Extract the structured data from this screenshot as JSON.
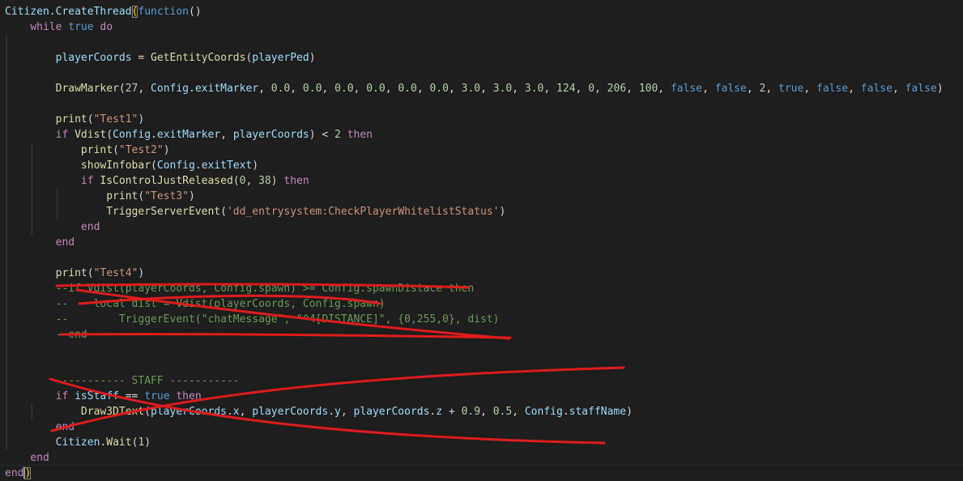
{
  "colors": {
    "background": "#1e1e1e",
    "default": "#d4d4d4",
    "keyword": "#569cd6",
    "control": "#c586c0",
    "function": "#dcdcaa",
    "variable": "#9cdcfe",
    "number": "#b5cea8",
    "string": "#ce9178",
    "comment": "#6a9955",
    "bracket": "#ffd700",
    "annotation": "#e01b1b"
  },
  "lines": [
    {
      "indent": 0,
      "tokens": [
        [
          "Citizen.CreateThread",
          "variable"
        ],
        [
          "(",
          "bracket-hl-tok"
        ],
        [
          "function",
          "keyword"
        ],
        [
          "()",
          "default"
        ]
      ]
    },
    {
      "indent": 1,
      "tokens": [
        [
          "while",
          "control"
        ],
        [
          " ",
          "default"
        ],
        [
          "true",
          "keyword"
        ],
        [
          " ",
          "default"
        ],
        [
          "do",
          "control"
        ]
      ]
    },
    {
      "indent": 2,
      "tokens": []
    },
    {
      "indent": 2,
      "tokens": [
        [
          "playerCoords",
          "variable"
        ],
        [
          " = ",
          "default"
        ],
        [
          "GetEntityCoords",
          "function"
        ],
        [
          "(",
          "default"
        ],
        [
          "playerPed",
          "variable"
        ],
        [
          ")",
          "default"
        ]
      ]
    },
    {
      "indent": 2,
      "tokens": []
    },
    {
      "indent": 2,
      "tokens": [
        [
          "DrawMarker",
          "function"
        ],
        [
          "(",
          "default"
        ],
        [
          "27",
          "number"
        ],
        [
          ", ",
          "default"
        ],
        [
          "Config",
          "variable"
        ],
        [
          ".",
          "default"
        ],
        [
          "exitMarker",
          "variable"
        ],
        [
          ", ",
          "default"
        ],
        [
          "0.0",
          "number"
        ],
        [
          ", ",
          "default"
        ],
        [
          "0.0",
          "number"
        ],
        [
          ", ",
          "default"
        ],
        [
          "0.0",
          "number"
        ],
        [
          ", ",
          "default"
        ],
        [
          "0.0",
          "number"
        ],
        [
          ", ",
          "default"
        ],
        [
          "0.0",
          "number"
        ],
        [
          ", ",
          "default"
        ],
        [
          "0.0",
          "number"
        ],
        [
          ", ",
          "default"
        ],
        [
          "3.0",
          "number"
        ],
        [
          ", ",
          "default"
        ],
        [
          "3.0",
          "number"
        ],
        [
          ", ",
          "default"
        ],
        [
          "3.0",
          "number"
        ],
        [
          ", ",
          "default"
        ],
        [
          "124",
          "number"
        ],
        [
          ", ",
          "default"
        ],
        [
          "0",
          "number"
        ],
        [
          ", ",
          "default"
        ],
        [
          "206",
          "number"
        ],
        [
          ", ",
          "default"
        ],
        [
          "100",
          "number"
        ],
        [
          ", ",
          "default"
        ],
        [
          "false",
          "keyword"
        ],
        [
          ", ",
          "default"
        ],
        [
          "false",
          "keyword"
        ],
        [
          ", ",
          "default"
        ],
        [
          "2",
          "number"
        ],
        [
          ", ",
          "default"
        ],
        [
          "true",
          "keyword"
        ],
        [
          ", ",
          "default"
        ],
        [
          "false",
          "keyword"
        ],
        [
          ", ",
          "default"
        ],
        [
          "false",
          "keyword"
        ],
        [
          ", ",
          "default"
        ],
        [
          "false",
          "keyword"
        ],
        [
          ")",
          "default"
        ]
      ]
    },
    {
      "indent": 2,
      "tokens": []
    },
    {
      "indent": 2,
      "tokens": [
        [
          "print",
          "function"
        ],
        [
          "(",
          "default"
        ],
        [
          "\"Test1\"",
          "string"
        ],
        [
          ")",
          "default"
        ]
      ]
    },
    {
      "indent": 2,
      "tokens": [
        [
          "if",
          "control"
        ],
        [
          " ",
          "default"
        ],
        [
          "Vdist",
          "function"
        ],
        [
          "(",
          "default"
        ],
        [
          "Config",
          "variable"
        ],
        [
          ".",
          "default"
        ],
        [
          "exitMarker",
          "variable"
        ],
        [
          ", ",
          "default"
        ],
        [
          "playerCoords",
          "variable"
        ],
        [
          ") < ",
          "default"
        ],
        [
          "2",
          "number"
        ],
        [
          " ",
          "default"
        ],
        [
          "then",
          "control"
        ]
      ]
    },
    {
      "indent": 3,
      "tokens": [
        [
          "print",
          "function"
        ],
        [
          "(",
          "default"
        ],
        [
          "\"Test2\"",
          "string"
        ],
        [
          ")",
          "default"
        ]
      ]
    },
    {
      "indent": 3,
      "tokens": [
        [
          "showInfobar",
          "function"
        ],
        [
          "(",
          "default"
        ],
        [
          "Config",
          "variable"
        ],
        [
          ".",
          "default"
        ],
        [
          "exitText",
          "variable"
        ],
        [
          ")",
          "default"
        ]
      ]
    },
    {
      "indent": 3,
      "tokens": [
        [
          "if",
          "control"
        ],
        [
          " ",
          "default"
        ],
        [
          "IsControlJustReleased",
          "function"
        ],
        [
          "(",
          "default"
        ],
        [
          "0",
          "number"
        ],
        [
          ", ",
          "default"
        ],
        [
          "38",
          "number"
        ],
        [
          ") ",
          "default"
        ],
        [
          "then",
          "control"
        ]
      ]
    },
    {
      "indent": 4,
      "tokens": [
        [
          "print",
          "function"
        ],
        [
          "(",
          "default"
        ],
        [
          "\"Test3\"",
          "string"
        ],
        [
          ")",
          "default"
        ]
      ]
    },
    {
      "indent": 4,
      "tokens": [
        [
          "TriggerServerEvent",
          "function"
        ],
        [
          "(",
          "default"
        ],
        [
          "'dd_entrysystem:CheckPlayerWhitelistStatus'",
          "string"
        ],
        [
          ")",
          "default"
        ]
      ]
    },
    {
      "indent": 3,
      "tokens": [
        [
          "end",
          "control"
        ]
      ]
    },
    {
      "indent": 2,
      "tokens": [
        [
          "end",
          "control"
        ]
      ]
    },
    {
      "indent": 2,
      "tokens": []
    },
    {
      "indent": 2,
      "tokens": [
        [
          "print",
          "function"
        ],
        [
          "(",
          "default"
        ],
        [
          "\"Test4\"",
          "string"
        ],
        [
          ")",
          "default"
        ]
      ]
    },
    {
      "indent": 2,
      "tokens": [
        [
          "--if Vdist(playerCoords, Config.spawn) >= Config.spawnDistace then",
          "comment"
        ]
      ]
    },
    {
      "indent": 2,
      "tokens": [
        [
          "--    local dist = Vdist(playerCoords, Config.spawn)",
          "comment"
        ]
      ]
    },
    {
      "indent": 2,
      "tokens": [
        [
          "--        TriggerEvent(\"chatMessage\", \"^4[DISTANCE]\", {0,255,0}, dist)",
          "comment"
        ]
      ]
    },
    {
      "indent": 2,
      "tokens": [
        [
          "--end",
          "comment"
        ]
      ]
    },
    {
      "indent": 2,
      "tokens": []
    },
    {
      "indent": 2,
      "tokens": []
    },
    {
      "indent": 2,
      "tokens": [
        [
          "----------- STAFF -----------",
          "comment"
        ]
      ]
    },
    {
      "indent": 2,
      "tokens": [
        [
          "if",
          "control"
        ],
        [
          " ",
          "default"
        ],
        [
          "isStaff",
          "variable"
        ],
        [
          " == ",
          "default"
        ],
        [
          "true",
          "keyword"
        ],
        [
          " ",
          "default"
        ],
        [
          "then",
          "control"
        ]
      ]
    },
    {
      "indent": 3,
      "tokens": [
        [
          "Draw3DText",
          "function"
        ],
        [
          "(",
          "default"
        ],
        [
          "playerCoords",
          "variable"
        ],
        [
          ".",
          "default"
        ],
        [
          "x",
          "variable"
        ],
        [
          ", ",
          "default"
        ],
        [
          "playerCoords",
          "variable"
        ],
        [
          ".",
          "default"
        ],
        [
          "y",
          "variable"
        ],
        [
          ", ",
          "default"
        ],
        [
          "playerCoords",
          "variable"
        ],
        [
          ".",
          "default"
        ],
        [
          "z",
          "variable"
        ],
        [
          " + ",
          "default"
        ],
        [
          "0.9",
          "number"
        ],
        [
          ", ",
          "default"
        ],
        [
          "0.5",
          "number"
        ],
        [
          ", ",
          "default"
        ],
        [
          "Config",
          "variable"
        ],
        [
          ".",
          "default"
        ],
        [
          "staffName",
          "variable"
        ],
        [
          ")",
          "default"
        ]
      ]
    },
    {
      "indent": 2,
      "tokens": [
        [
          "end",
          "control"
        ]
      ]
    },
    {
      "indent": 2,
      "tokens": [
        [
          "Citizen",
          "variable"
        ],
        [
          ".",
          "default"
        ],
        [
          "Wait",
          "function"
        ],
        [
          "(",
          "default"
        ],
        [
          "1",
          "number"
        ],
        [
          ")",
          "default"
        ]
      ]
    },
    {
      "indent": 1,
      "tokens": [
        [
          "end",
          "control"
        ]
      ]
    },
    {
      "indent": 0,
      "tokens": [
        [
          "end",
          "control"
        ],
        [
          ")",
          "bracket-hl-tok"
        ]
      ],
      "current": true
    }
  ]
}
